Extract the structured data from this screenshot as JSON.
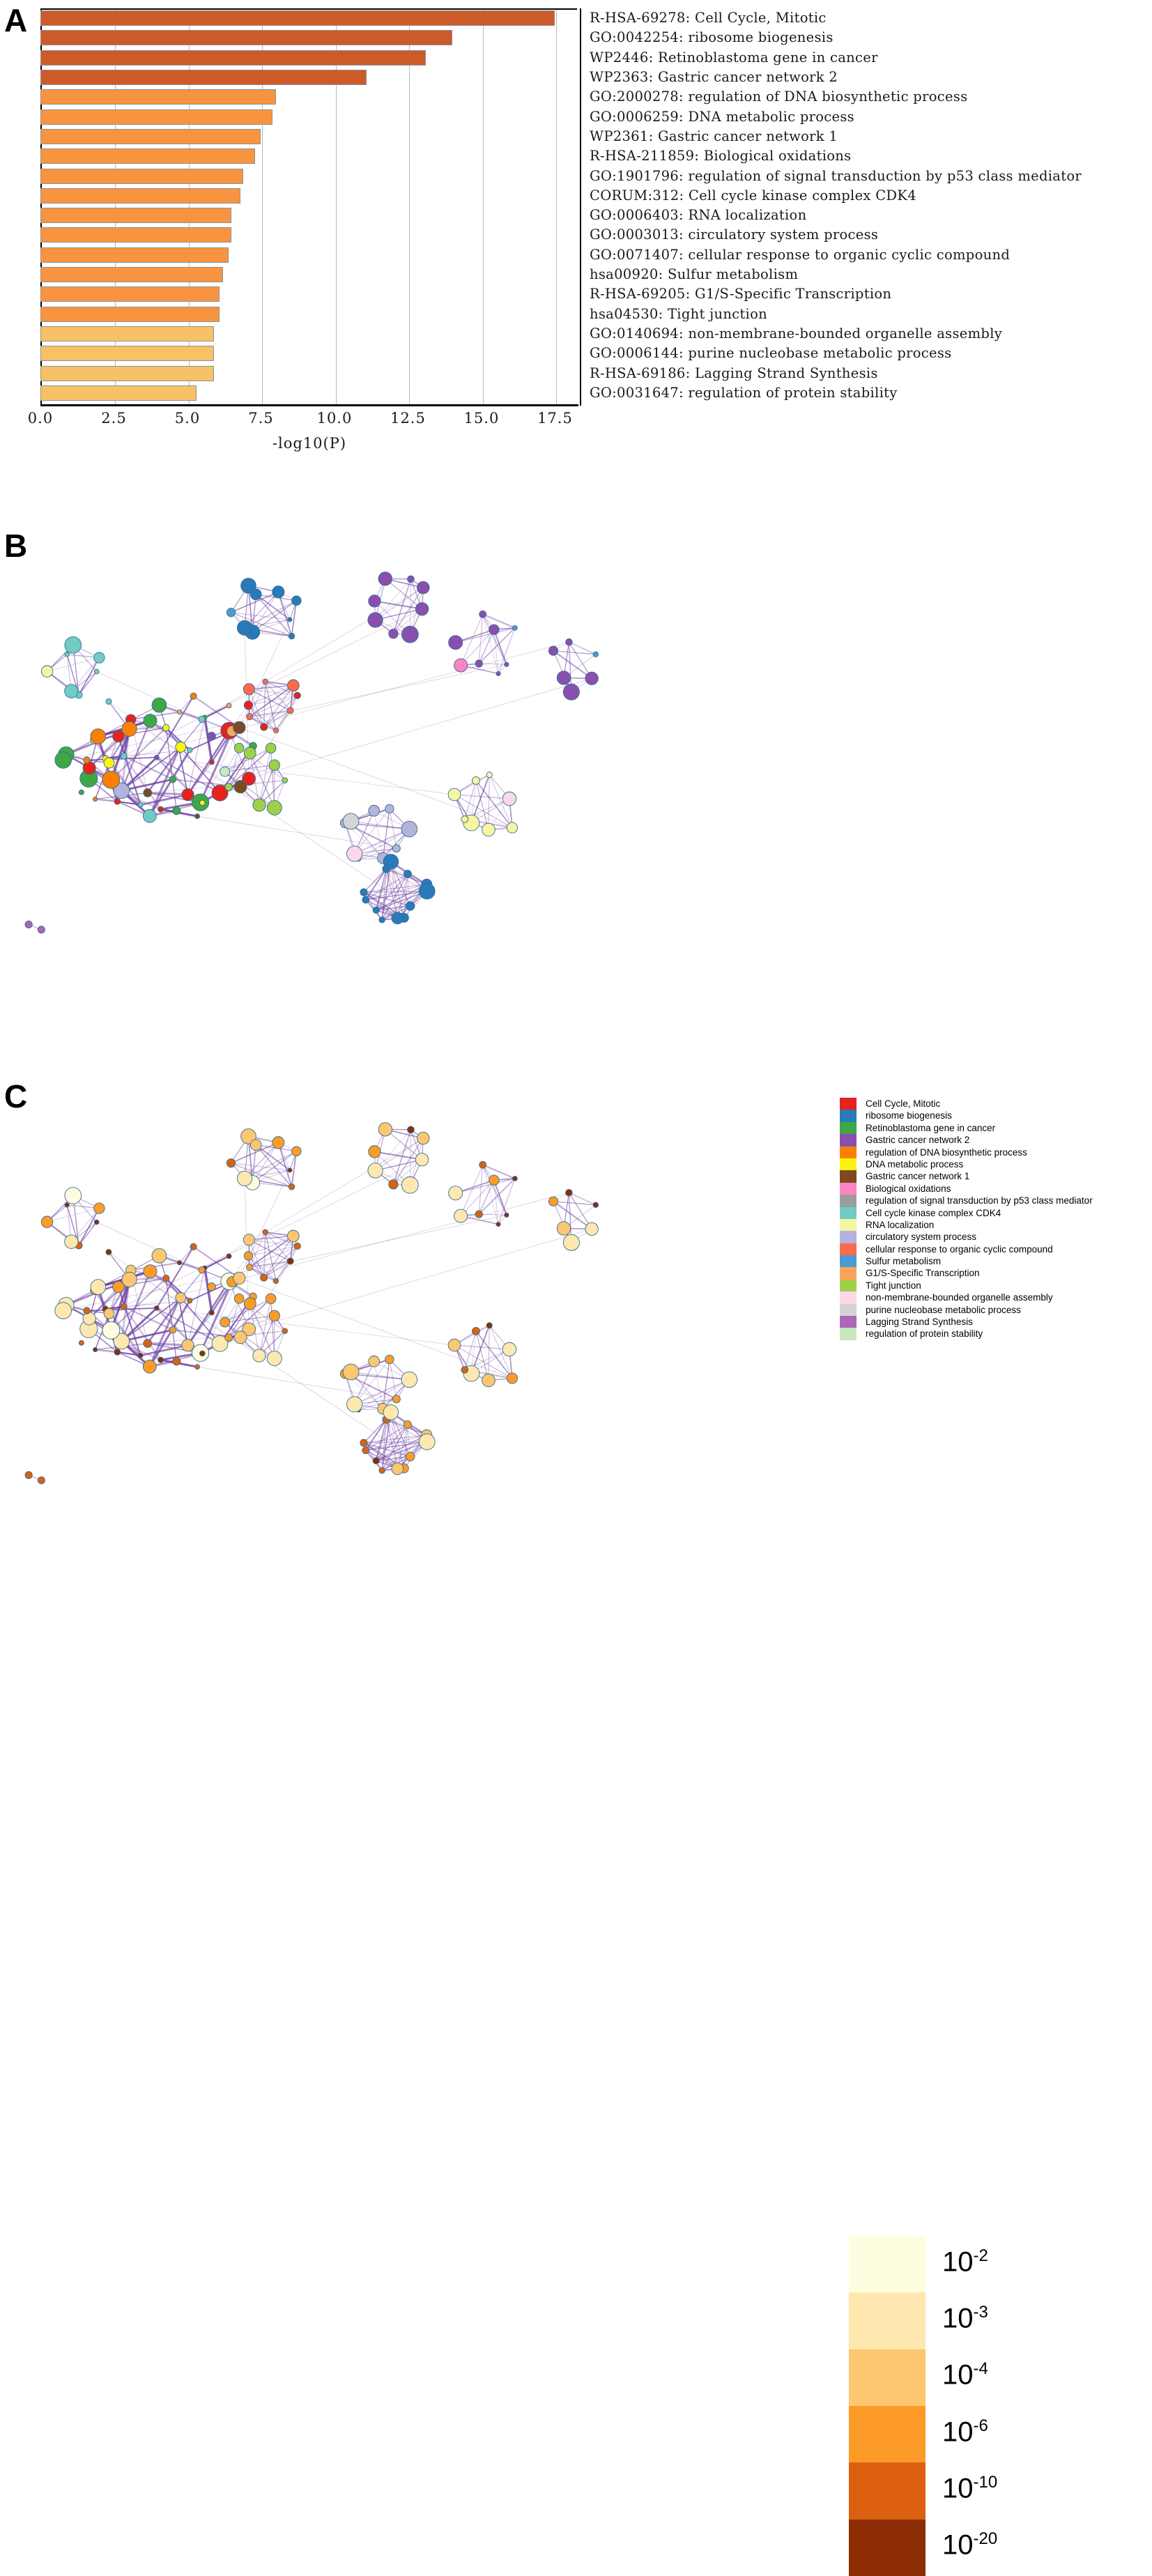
{
  "panels": {
    "a_letter": "A",
    "b_letter": "B",
    "c_letter": "C"
  },
  "chart_data": [
    {
      "type": "bar",
      "orientation": "horizontal",
      "title": "",
      "xlabel": "-log10(P)",
      "ylabel": "",
      "xlim": [
        0,
        18.2
      ],
      "xticks": [
        "0.0",
        "2.5",
        "5.0",
        "7.5",
        "10.0",
        "12.5",
        "15.0",
        "17.5"
      ],
      "xtick_values": [
        0,
        2.5,
        5.0,
        7.5,
        10.0,
        12.5,
        15.0,
        17.5
      ],
      "grid": true,
      "categories": [
        "R-HSA-69278: Cell Cycle, Mitotic",
        "GO:0042254: ribosome biogenesis",
        "WP2446: Retinoblastoma gene in cancer",
        "WP2363: Gastric cancer network 2",
        "GO:2000278: regulation of DNA biosynthetic process",
        "GO:0006259: DNA metabolic process",
        "WP2361: Gastric cancer network 1",
        "R-HSA-211859: Biological oxidations",
        "GO:1901796: regulation of signal transduction by p53 class mediator",
        "CORUM:312: Cell cycle kinase complex CDK4",
        "GO:0006403: RNA localization",
        "GO:0003013: circulatory system process",
        "GO:0071407: cellular response to organic cyclic compound",
        "hsa00920: Sulfur metabolism",
        "R-HSA-69205: G1/S-Specific Transcription",
        "hsa04530: Tight junction",
        "GO:0140694: non-membrane-bounded organelle assembly",
        "GO:0006144: purine nucleobase metabolic process",
        "R-HSA-69186: Lagging Strand Synthesis",
        "GO:0031647: regulation of protein stability"
      ],
      "values": [
        17.5,
        14.0,
        13.1,
        11.1,
        8.0,
        7.9,
        7.5,
        7.3,
        6.9,
        6.8,
        6.5,
        6.5,
        6.4,
        6.2,
        6.1,
        6.1,
        5.9,
        5.9,
        5.9,
        5.3
      ],
      "bar_colors": [
        "#cd5b29",
        "#cd5b29",
        "#cd5b29",
        "#cd5b29",
        "#f89440",
        "#f89440",
        "#f89440",
        "#f89440",
        "#f89440",
        "#f89440",
        "#f89440",
        "#f89440",
        "#f89440",
        "#f89440",
        "#f89440",
        "#f89440",
        "#f7c167",
        "#f7c167",
        "#f7c167",
        "#f7c167"
      ]
    },
    {
      "type": "scatter",
      "subtype": "network",
      "title": "B",
      "note": "Enrichment network colored by cluster identity"
    },
    {
      "type": "scatter",
      "subtype": "network",
      "title": "C",
      "note": "Enrichment network colored by p-value"
    }
  ],
  "legend_b": {
    "position": "right",
    "items": [
      {
        "label": "Cell Cycle, Mitotic",
        "color": "#e8211c"
      },
      {
        "label": "ribosome biogenesis",
        "color": "#2a7ab9"
      },
      {
        "label": "Retinoblastoma gene in cancer",
        "color": "#40a746"
      },
      {
        "label": "Gastric cancer network 2",
        "color": "#8a4fae"
      },
      {
        "label": "regulation of DNA biosynthetic process",
        "color": "#fb8001"
      },
      {
        "label": "DNA metabolic process",
        "color": "#fcf210"
      },
      {
        "label": "Gastric cancer network 1",
        "color": "#7c4a1e"
      },
      {
        "label": "Biological oxidations",
        "color": "#fb84c2"
      },
      {
        "label": "regulation of signal transduction by p53 class mediator",
        "color": "#9c9c9c"
      },
      {
        "label": "Cell cycle kinase complex CDK4",
        "color": "#72cbc4"
      },
      {
        "label": "RNA localization",
        "color": "#f6f5a2"
      },
      {
        "label": "circulatory system process",
        "color": "#b3b3dc"
      },
      {
        "label": "cellular response to organic cyclic compound",
        "color": "#fb6a4b"
      },
      {
        "label": "Sulfur metabolism",
        "color": "#4e9bd1"
      },
      {
        "label": "G1/S-Specific Transcription",
        "color": "#fca55a"
      },
      {
        "label": "Tight junction",
        "color": "#a0d04a"
      },
      {
        "label": "non-membrane-bounded organelle assembly",
        "color": "#fbd7e9"
      },
      {
        "label": "purine nucleobase metabolic process",
        "color": "#d4d4d4"
      },
      {
        "label": "Lagging Strand Synthesis",
        "color": "#ab67b8"
      },
      {
        "label": "regulation of protein stability",
        "color": "#cbe7c0"
      }
    ]
  },
  "colorbar_c": {
    "position": "right",
    "bands": [
      {
        "color": "#fffddf",
        "base": "10",
        "exp": "-2"
      },
      {
        "color": "#fee8af",
        "base": "10",
        "exp": "-3"
      },
      {
        "color": "#fdc košmar",
        "base": "10",
        "exp": "-4"
      },
      {
        "color": "#fd9b28",
        "base": "10",
        "exp": "-6"
      },
      {
        "color": "#dd6011",
        "base": "10",
        "exp": "-10"
      },
      {
        "color": "#8c2d04",
        "base": "10",
        "exp": "-20"
      }
    ]
  }
}
